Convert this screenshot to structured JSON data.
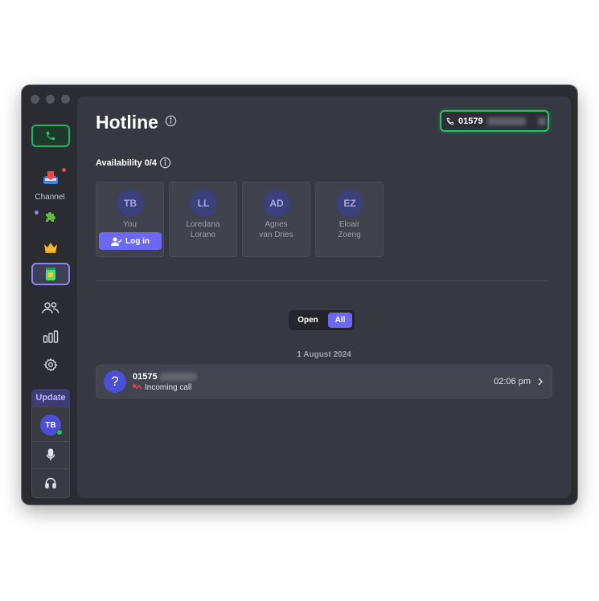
{
  "sidebar": {
    "channel_label": "Channel",
    "update_label": "Update",
    "user_initials": "TB"
  },
  "main": {
    "title": "Hotline",
    "phone_number_visible": "01579",
    "availability_label": "Availability 0/4",
    "agents": [
      {
        "initials": "TB",
        "name_line1": "You",
        "name_line2": "",
        "login_label": "Log in"
      },
      {
        "initials": "LL",
        "name_line1": "Loredana",
        "name_line2": "Lorano"
      },
      {
        "initials": "AD",
        "name_line1": "Agnes",
        "name_line2": "van Dries"
      },
      {
        "initials": "EZ",
        "name_line1": "Eloair",
        "name_line2": "Zoeng"
      }
    ],
    "filter": {
      "open_label": "Open",
      "all_label": "All",
      "selected": "All"
    },
    "date_label": "1 August 2024",
    "calls": [
      {
        "number_visible": "01575",
        "type": "Incoming call",
        "time": "02:06 pm",
        "avatar_glyph": "?"
      }
    ]
  },
  "colors": {
    "accent": "#6c68f2",
    "success": "#22c55e",
    "window_bg": "#2b2c31",
    "panel_bg": "#363842"
  }
}
